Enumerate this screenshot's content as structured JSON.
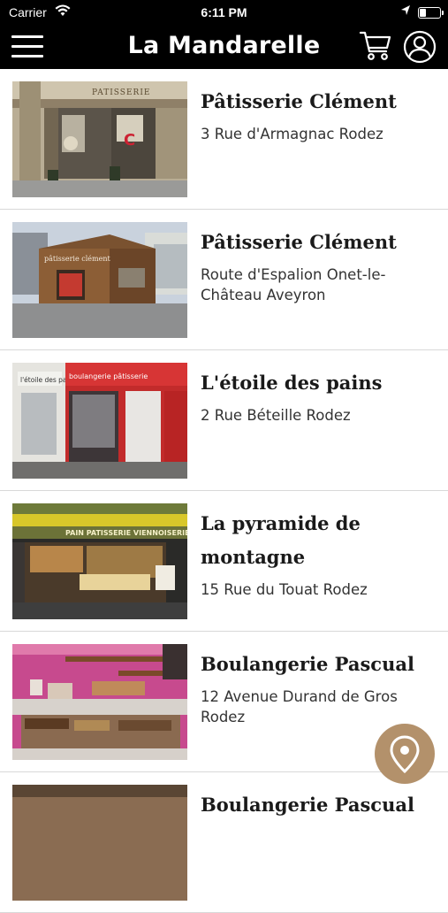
{
  "status": {
    "carrier": "Carrier",
    "time": "6:11 PM"
  },
  "header": {
    "title": "La Mandarelle"
  },
  "shops": [
    {
      "name": "Pâtisserie Clément",
      "address": "3 Rue d'Armagnac Rodez"
    },
    {
      "name": "Pâtisserie Clément",
      "address": "Route d'Espalion Onet-le-Château Aveyron"
    },
    {
      "name": "L'étoile des pains",
      "address": "2 Rue Béteille Rodez"
    },
    {
      "name": "La pyramide de montagne",
      "address": "15 Rue du Touat Rodez"
    },
    {
      "name": "Boulangerie Pascual",
      "address": "12 Avenue Durand de Gros Rodez"
    },
    {
      "name": "Boulangerie Pascual",
      "address": ""
    }
  ],
  "photo_text": {
    "shop1_sign": "PATISSERIE",
    "shop2_sign": "pâtisserie clément",
    "shop3_sign_left": "l'étoile des pains",
    "shop3_sign_right": "boulangerie pâtisserie",
    "shop4_sign": "PAIN  PATISSERIE  VIENNOISERIE"
  },
  "colors": {
    "accent": "#b3916b",
    "bar": "#000000"
  },
  "icons": [
    "wifi-icon",
    "location-arrow-icon",
    "battery-icon",
    "menu-icon",
    "cart-icon",
    "user-icon",
    "map-pin-icon"
  ]
}
